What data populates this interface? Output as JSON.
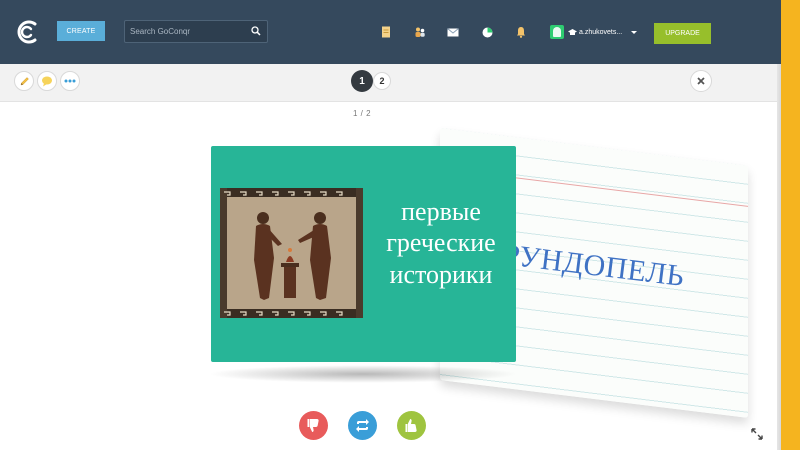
{
  "header": {
    "create_label": "CREATE",
    "search_placeholder": "Search GoConqr",
    "username": "a.zhukovets...",
    "upgrade_label": "UPGRADE",
    "icons": [
      "logo-icon",
      "search-icon",
      "notes-icon",
      "friends-icon",
      "mail-icon",
      "progress-icon",
      "notifications-icon",
      "avatar-icon",
      "chevron-down-icon"
    ]
  },
  "toolbar": {
    "pages": [
      "1",
      "2"
    ],
    "icons": [
      "pencil-icon",
      "comment-icon",
      "more-icon",
      "close-icon"
    ]
  },
  "counter": "1 / 2",
  "front_card": {
    "text_lines": [
      "первые",
      "греческие",
      "историки"
    ]
  },
  "back_card": {
    "text": "РУНДОПЕЛЬ"
  },
  "actions": {
    "icons": [
      "thumbs-down-icon",
      "flip-icon",
      "thumbs-up-icon",
      "expand-icon"
    ]
  },
  "colors": {
    "topbar": "#35495d",
    "create": "#5aaed9",
    "upgrade": "#97bf2b",
    "card": "#27b597",
    "dislike": "#e85b5b",
    "flip": "#3a9ed8",
    "like": "#9fc43f",
    "rail": "#f5b41f"
  }
}
